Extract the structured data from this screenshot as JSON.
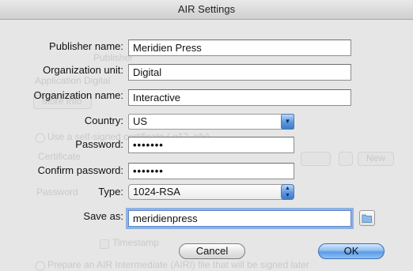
{
  "window": {
    "title": "AIR Settings"
  },
  "background_ghost": {
    "publisher": "Publisher",
    "app_digital": "Application Digital",
    "more_info": "More Info",
    "use_certificate": "Use a self-signed certificate (.p12,.pfx)",
    "certificate": "Certificate",
    "new": "New",
    "password": "Password",
    "timestamp": "Timestamp",
    "prepare": "Prepare an AIR Intermediate (AIRI) file that will be signed later"
  },
  "form": {
    "publisher_name": {
      "label": "Publisher name:",
      "value": "Meridien Press"
    },
    "organization_unit": {
      "label": "Organization unit:",
      "value": "Digital"
    },
    "organization_name": {
      "label": "Organization name:",
      "value": "Interactive"
    },
    "country": {
      "label": "Country:",
      "value": "US",
      "arrow": "chevron-down-icon"
    },
    "password": {
      "label": "Password:",
      "value": "•••••••"
    },
    "confirm_password": {
      "label": "Confirm password:",
      "value": "•••••••"
    },
    "type": {
      "label": "Type:",
      "value": "1024-RSA",
      "arrow": "up-down-arrows-icon"
    },
    "save_as": {
      "label": "Save as:",
      "value": "meridienpress",
      "browse_icon": "folder-icon"
    }
  },
  "buttons": {
    "cancel": "Cancel",
    "ok": "OK"
  }
}
